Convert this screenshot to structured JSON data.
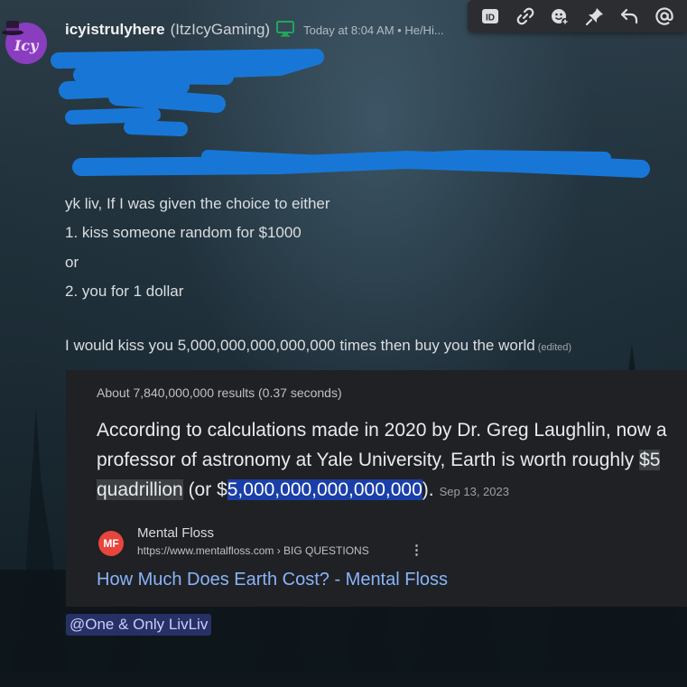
{
  "author": {
    "username": "icyistrulyhere",
    "nickname": "(ItzIcyGaming)",
    "avatar_text": "Icy",
    "device_icon": "desktop-icon",
    "timestamp": "Today at 8:04 AM • He/Hi..."
  },
  "toolbar": {
    "icons": [
      "id-icon",
      "link-icon",
      "add-reaction-icon",
      "pin-icon",
      "reply-icon",
      "mention-icon"
    ],
    "id_label": "ID"
  },
  "message": {
    "line1": "yk liv, If I was given the choice to either",
    "line2": "1. kiss someone random for $1000",
    "line3": "or",
    "line4": "2. you for 1 dollar",
    "line5": "I would kiss you 5,000,000,000,000,000 times then buy you the world",
    "edited": "(edited)"
  },
  "embed": {
    "results_count": "About 7,840,000,000 results (0.37 seconds)",
    "answer_part1": "According to calculations made in 2020 by Dr. Greg Laughlin, now a professor of astronomy at Yale University, Earth is worth roughly ",
    "answer_highlight1": "$5 quadrillion",
    "answer_part2": " (or $",
    "answer_highlight2": "5,000,000,000,000,000",
    "answer_part3": ").",
    "answer_date": "Sep 13, 2023",
    "source_logo": "MF",
    "source_name": "Mental Floss",
    "source_url": "https://www.mentalfloss.com › BIG QUESTIONS",
    "more_icon": "⋮",
    "link_title": "How Much Does Earth Cost? - Mental Floss"
  },
  "mention": "@One & Only LivLiv",
  "colors": {
    "accent_blue": "#1a73e8",
    "link": "#8ab4f8",
    "mention_bg": "#5865f2",
    "online_green": "#23a559",
    "redaction": "#1877d6"
  }
}
